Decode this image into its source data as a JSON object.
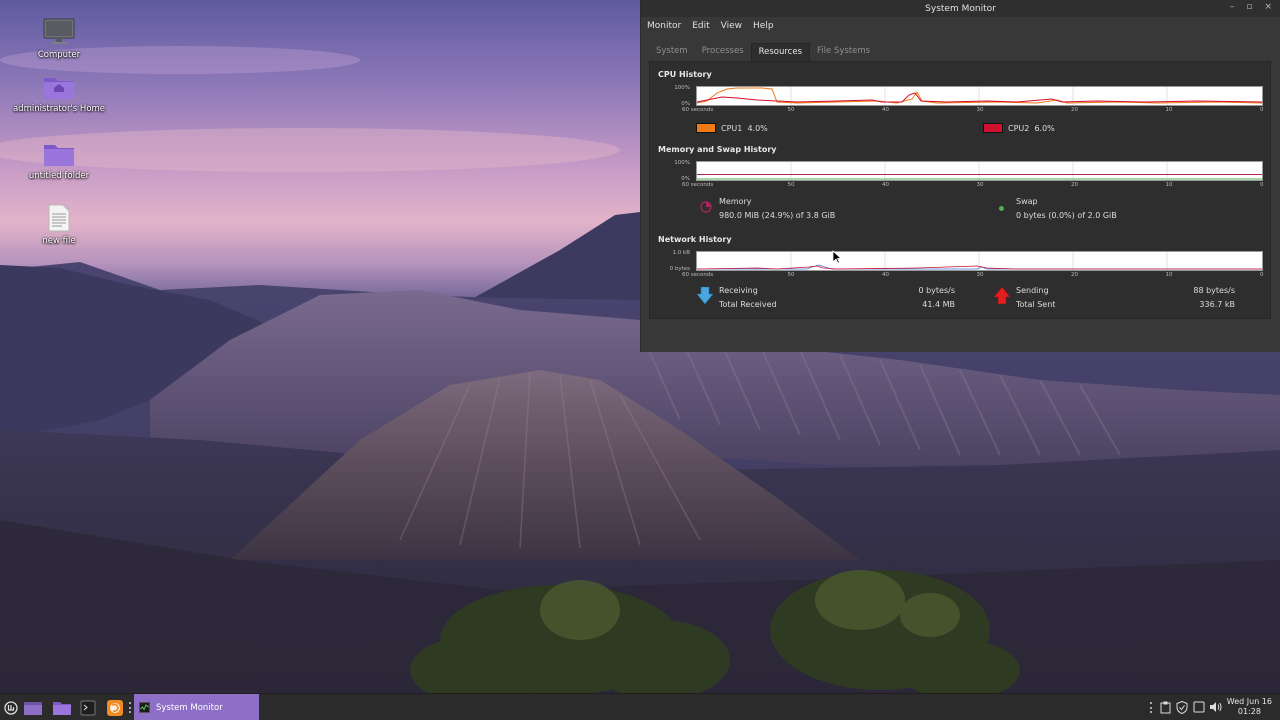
{
  "desktop": {
    "icons": [
      {
        "label": "Computer",
        "icon": "computer-icon"
      },
      {
        "label": "administrator's Home",
        "icon": "home-folder-icon"
      },
      {
        "label": "untitled folder",
        "icon": "folder-icon"
      },
      {
        "label": "new file",
        "icon": "text-file-icon"
      }
    ]
  },
  "window": {
    "title": "System Monitor",
    "controls": {
      "minimize": "–",
      "maximize": "▫",
      "close": "×"
    },
    "menu": [
      "Monitor",
      "Edit",
      "View",
      "Help"
    ],
    "tabs": [
      "System",
      "Processes",
      "Resources",
      "File Systems"
    ],
    "active_tab": "Resources"
  },
  "cpu": {
    "title": "CPU History",
    "y_top": "100%",
    "y_bottom": "0%",
    "x_ticks": [
      "60 seconds",
      "50",
      "40",
      "30",
      "20",
      "10",
      "0"
    ],
    "legend": [
      {
        "label": "CPU1",
        "value": "4.0%",
        "color": "#f07a16"
      },
      {
        "label": "CPU2",
        "value": "6.0%",
        "color": "#d0102e"
      }
    ]
  },
  "memory": {
    "title": "Memory and Swap History",
    "y_top": "100%",
    "y_bottom": "0%",
    "x_ticks": [
      "60 seconds",
      "50",
      "40",
      "30",
      "20",
      "10",
      "0"
    ],
    "memory_label": "Memory",
    "memory_value": "980.0 MiB (24.9%) of 3.8 GiB",
    "swap_label": "Swap",
    "swap_value": "0 bytes (0.0%) of 2.0 GiB",
    "memory_color": "#b0245e",
    "swap_color": "#4caf50"
  },
  "network": {
    "title": "Network History",
    "y_top": "1.0 kB",
    "y_bottom": "0 bytes",
    "x_ticks": [
      "60 seconds",
      "50",
      "40",
      "30",
      "20",
      "10",
      "0"
    ],
    "receiving_label": "Receiving",
    "receiving_value": "0 bytes/s",
    "total_received_label": "Total Received",
    "total_received_value": "41.4 MB",
    "sending_label": "Sending",
    "sending_value": "88 bytes/s",
    "total_sent_label": "Total Sent",
    "total_sent_value": "336.7 kB"
  },
  "taskbar": {
    "task_label": "System Monitor",
    "clock_date": "Wed Jun 16",
    "clock_time": "01:28",
    "accent": "#8d6fc7"
  }
}
